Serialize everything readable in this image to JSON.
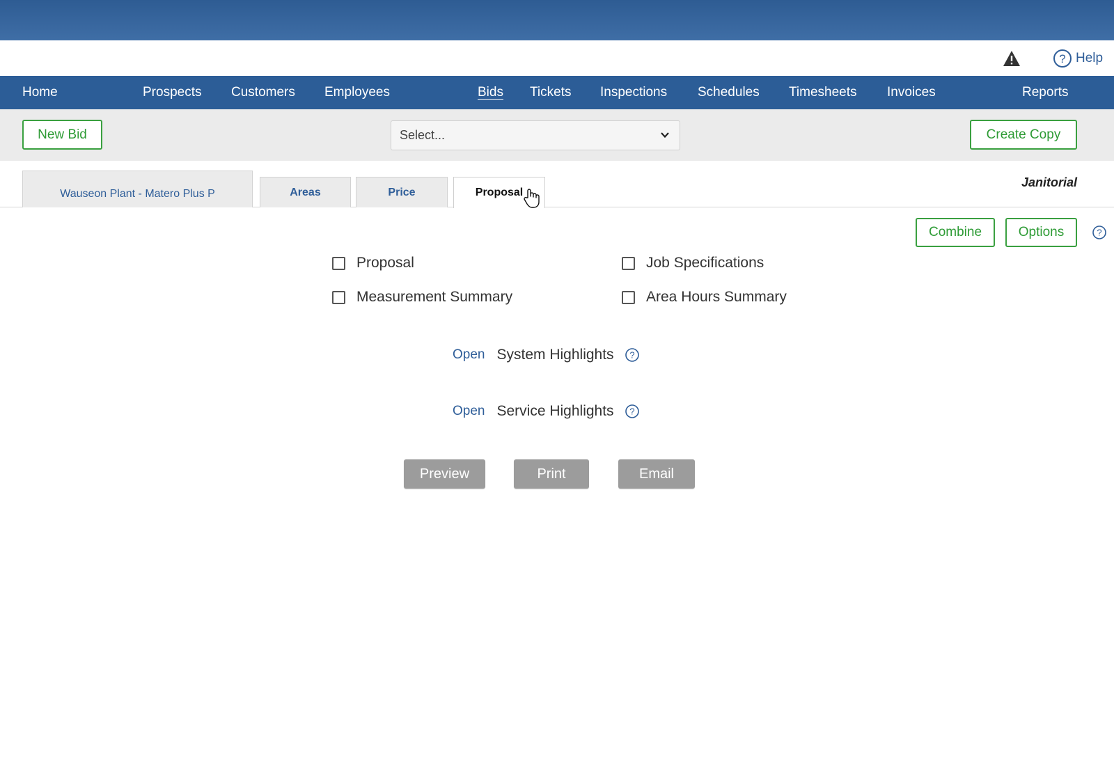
{
  "header": {
    "help_label": "Help"
  },
  "nav": {
    "items": [
      {
        "label": "Home"
      },
      {
        "label": "Prospects"
      },
      {
        "label": "Customers"
      },
      {
        "label": "Employees"
      },
      {
        "label": "Bids",
        "active": true
      },
      {
        "label": "Tickets"
      },
      {
        "label": "Inspections"
      },
      {
        "label": "Schedules"
      },
      {
        "label": "Timesheets"
      },
      {
        "label": "Invoices"
      },
      {
        "label": "Reports"
      }
    ]
  },
  "toolbar": {
    "new_bid_label": "New Bid",
    "select_value": "Select...",
    "create_copy_label": "Create Copy"
  },
  "tabs": {
    "bid_name": "Wauseon Plant - Matero Plus P",
    "areas": "Areas",
    "price": "Price",
    "proposal": "Proposal",
    "active": "Proposal"
  },
  "category_label": "Janitorial",
  "actions": {
    "combine_label": "Combine",
    "options_label": "Options"
  },
  "documents": {
    "proposal": "Proposal",
    "job_specifications": "Job Specifications",
    "measurement_summary": "Measurement Summary",
    "area_hours_summary": "Area Hours Summary"
  },
  "sections": [
    {
      "open_label": "Open",
      "label": "System Highlights"
    },
    {
      "open_label": "Open",
      "label": "Service Highlights"
    }
  ],
  "buttons": {
    "preview": "Preview",
    "print": "Print",
    "email": "Email"
  },
  "colors": {
    "nav_blue": "#2c5d97",
    "link_blue": "#2f5e99",
    "green": "#2e9b35",
    "gray_button": "#9c9c9c"
  },
  "icons": [
    "warning-icon",
    "help-icon",
    "chevron-down-icon",
    "hand-cursor-icon"
  ]
}
